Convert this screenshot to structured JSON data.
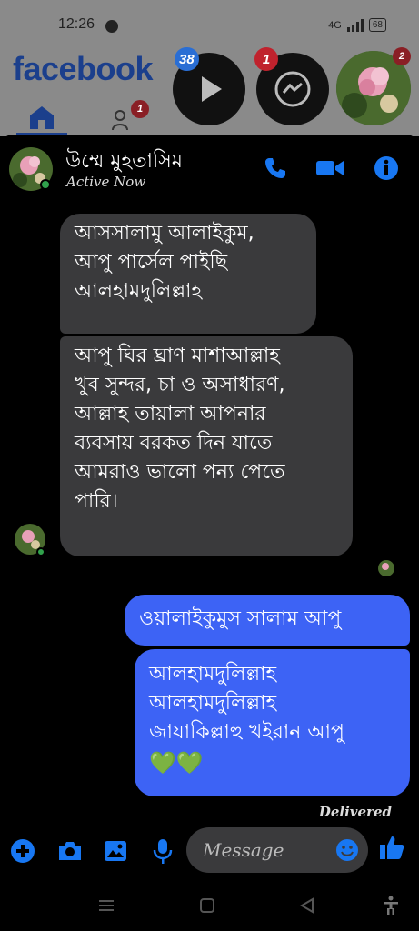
{
  "status_bar": {
    "time": "12:26",
    "network": "4G",
    "battery": "68"
  },
  "background_app": {
    "logo": "facebook",
    "watch_badge": "38",
    "messenger_badge": "1",
    "profile_badge": "2",
    "friends_badge": "1"
  },
  "chat": {
    "contact_name": "উম্মে মুহতাসিম",
    "contact_status": "Active Now",
    "icons": {
      "call": "phone-icon",
      "video": "video-camera-icon",
      "info": "info-icon"
    },
    "messages": [
      {
        "direction": "incoming",
        "text": "আসসালামু আলাইকুম,\nআপু পার্সেল পাইছি\nআলহামদুলিল্লাহ"
      },
      {
        "direction": "incoming",
        "text": "আপু ঘির ঘ্রাণ মাশাআল্লাহ\nখুব সুন্দর, চা ও অসাধারণ,\nআল্লাহ তায়ালা আপনার\nব্যবসায় বরকত দিন যাতে\nআমরাও ভালো পন্য পেতে\nপারি।"
      },
      {
        "direction": "outgoing",
        "text": "ওয়ালাইকুমুস সালাম আপু"
      },
      {
        "direction": "outgoing",
        "text": "আলহামদুলিল্লাহ\nআলহামদুলিল্লাহ\nজাযাকিল্লাহু খইরান আপু"
      }
    ],
    "emoji_hearts": "💚💚",
    "delivery_status": "Delivered"
  },
  "composer": {
    "placeholder": "Message",
    "icons": [
      "plus-icon",
      "camera-icon",
      "gallery-icon",
      "microphone-icon",
      "emoji-icon",
      "thumbs-up-icon"
    ]
  },
  "colors": {
    "accent": "#1877f2",
    "outgoing_bubble": "#3d63f5",
    "incoming_bubble": "#3a3a3c",
    "online": "#31a24c"
  }
}
